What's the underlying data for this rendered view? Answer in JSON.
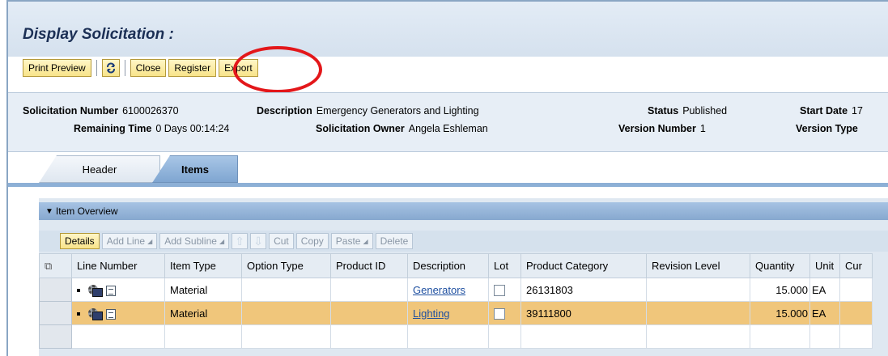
{
  "page": {
    "title": "Display Solicitation :"
  },
  "toolbar": {
    "print_preview": "Print Preview",
    "refresh_icon": "refresh-icon",
    "close": "Close",
    "register": "Register",
    "export": "Export"
  },
  "annotation": {
    "highlight_color": "#e3171a"
  },
  "header": {
    "solicitation_number": {
      "label": "Solicitation Number",
      "value": "6100026370"
    },
    "remaining_time": {
      "label": "Remaining Time",
      "value": "0 Days 00:14:24"
    },
    "description": {
      "label": "Description",
      "value": "Emergency Generators and Lighting"
    },
    "solicitation_owner": {
      "label": "Solicitation Owner",
      "value": "Angela Eshleman"
    },
    "status": {
      "label": "Status",
      "value": "Published"
    },
    "version_number": {
      "label": "Version Number",
      "value": "1"
    },
    "start_date": {
      "label": "Start Date",
      "value": "17"
    },
    "version_type": {
      "label": "Version Type",
      "value": ""
    }
  },
  "tabs": [
    {
      "label": "Header",
      "active": false
    },
    {
      "label": "Items",
      "active": true
    }
  ],
  "item_overview": {
    "title": "Item Overview",
    "toolbar": {
      "details": "Details",
      "add_line": "Add Line",
      "add_subline": "Add Subline",
      "cut": "Cut",
      "copy": "Copy",
      "paste": "Paste",
      "delete": "Delete"
    },
    "columns": [
      "Line Number",
      "Item Type",
      "Option Type",
      "Product ID",
      "Description",
      "Lot",
      "Product Category",
      "Revision Level",
      "Quantity",
      "Unit",
      "Cur"
    ],
    "rows": [
      {
        "item_type": "Material",
        "option_type": "",
        "product_id": "",
        "description": "Generators",
        "lot": false,
        "product_category": "26131803",
        "revision_level": "",
        "quantity": "15.000",
        "unit": "EA",
        "currency": ""
      },
      {
        "item_type": "Material",
        "option_type": "",
        "product_id": "",
        "description": "Lighting",
        "lot": false,
        "product_category": "39111800",
        "revision_level": "",
        "quantity": "15.000",
        "unit": "EA",
        "currency": ""
      }
    ]
  },
  "colors": {
    "button_yellow": "#f8e48a",
    "selected_row": "#f0c67b",
    "tab_active": "#8db0d6",
    "title_blue": "#1b2f55"
  }
}
